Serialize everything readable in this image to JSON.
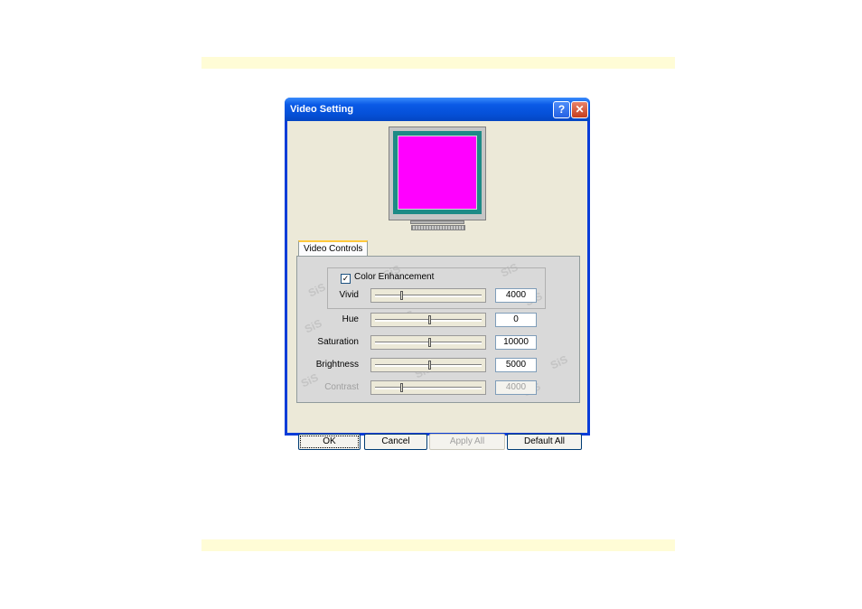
{
  "window": {
    "title": "Video Setting",
    "help_glyph": "?",
    "close_glyph": "✕"
  },
  "tabs": [
    {
      "label": "Video Controls"
    }
  ],
  "color_enhancement": {
    "label": "Color Enhancement",
    "checked": true,
    "check_glyph": "✓"
  },
  "controls": [
    {
      "label": "Vivid",
      "value": "4000",
      "fraction": 0.24,
      "enabled": true
    },
    {
      "label": "Hue",
      "value": "0",
      "fraction": 0.5,
      "enabled": true
    },
    {
      "label": "Saturation",
      "value": "10000",
      "fraction": 0.5,
      "enabled": true
    },
    {
      "label": "Brightness",
      "value": "5000",
      "fraction": 0.5,
      "enabled": true
    },
    {
      "label": "Contrast",
      "value": "4000",
      "fraction": 0.24,
      "enabled": false
    }
  ],
  "buttons": {
    "ok": "OK",
    "cancel": "Cancel",
    "apply_all": "Apply All",
    "default_all": "Default All"
  },
  "watermark": "SiS",
  "colors": {
    "monitor_screen": "#ff00ff",
    "titlebar": "#0550d8"
  }
}
